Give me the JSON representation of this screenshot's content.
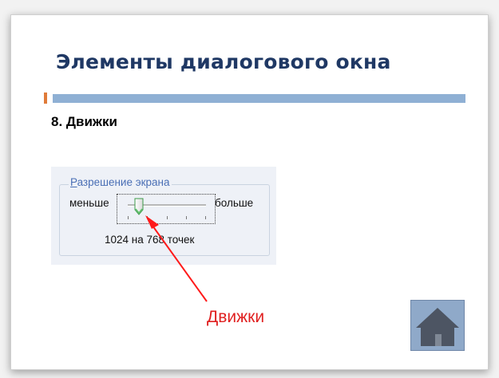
{
  "slide": {
    "title": "Элементы диалогового  окна",
    "section": "8. Движки"
  },
  "dialog": {
    "legend_first": "Р",
    "legend_rest": "азрешение экрана",
    "less_label": "меньше",
    "more_label": "больше",
    "resolution": "1024 на 768 точек",
    "slider_value": 0.2
  },
  "callout": {
    "label": "Движки"
  },
  "nav": {
    "home_icon": "home-icon"
  },
  "colors": {
    "title": "#1f3864",
    "accent_bar": "#8fb0d4",
    "accent_orange": "#e07b39",
    "callout": "#e02020",
    "home_button": "#8fa9c9"
  }
}
